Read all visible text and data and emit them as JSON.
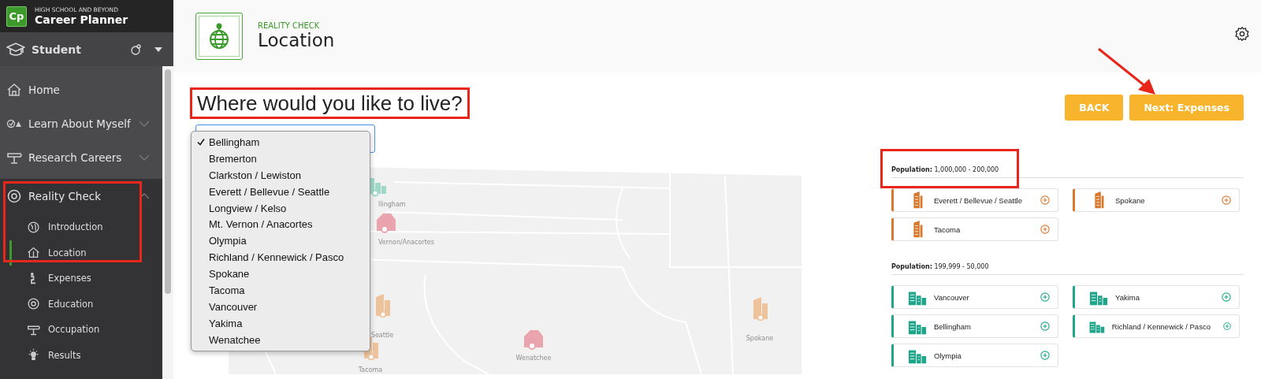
{
  "app": {
    "logo": "Cp",
    "subtitle": "HIGH SCHOOL AND BEYOND",
    "title": "Career Planner"
  },
  "user": {
    "name": "Student"
  },
  "nav": [
    {
      "kind": "link",
      "label": "Home"
    },
    {
      "kind": "group",
      "label": "Learn About Myself",
      "expanded": false
    },
    {
      "kind": "group",
      "label": "Research Careers",
      "expanded": false
    },
    {
      "kind": "group",
      "label": "Reality Check",
      "expanded": true,
      "children": [
        {
          "label": "Introduction",
          "selected": false
        },
        {
          "label": "Location",
          "selected": true
        },
        {
          "label": "Expenses",
          "selected": false
        },
        {
          "label": "Education",
          "selected": false
        },
        {
          "label": "Occupation",
          "selected": false
        },
        {
          "label": "Results",
          "selected": false
        }
      ]
    }
  ],
  "page": {
    "section": "REALITY CHECK",
    "title": "Location"
  },
  "question": "Where would you like to live?",
  "select": {
    "options": [
      {
        "label": "Bellingham",
        "selected": true
      },
      {
        "label": "Bremerton",
        "selected": false
      },
      {
        "label": "Clarkston / Lewiston",
        "selected": false
      },
      {
        "label": "Everett / Bellevue / Seattle",
        "selected": false
      },
      {
        "label": "Longview / Kelso",
        "selected": false
      },
      {
        "label": "Mt. Vernon / Anacortes",
        "selected": false
      },
      {
        "label": "Olympia",
        "selected": false
      },
      {
        "label": "Richland / Kennewick / Pasco",
        "selected": false
      },
      {
        "label": "Spokane",
        "selected": false
      },
      {
        "label": "Tacoma",
        "selected": false
      },
      {
        "label": "Vancouver",
        "selected": false
      },
      {
        "label": "Yakima",
        "selected": false
      },
      {
        "label": "Wenatchee",
        "selected": false
      }
    ]
  },
  "map_pins": [
    {
      "kind": "building",
      "label": "llingham",
      "color": "#9fd8c8"
    },
    {
      "kind": "barn",
      "label": "Vernon/Anacortes",
      "color": "#eaa4ae"
    },
    {
      "kind": "tower",
      "label": "Seattle",
      "color": "#eec39c"
    },
    {
      "kind": "tower",
      "label": "Tacoma",
      "color": "#eec39c"
    },
    {
      "kind": "barn",
      "label": "Wenatchee",
      "color": "#eaa4ae"
    },
    {
      "kind": "tower",
      "label": "Spokane",
      "color": "#eec39c"
    }
  ],
  "buttons": [
    "BACK",
    "Next: Expenses"
  ],
  "groups": [
    {
      "heading": "**Population:** 1,000,000 - 200,000",
      "kind": "tower",
      "color": "#d9782d",
      "cities": [
        "Everett / Bellevue / Seattle",
        "Spokane",
        "Tacoma"
      ]
    },
    {
      "heading": "**Population:** 199,999 - 50,000",
      "kind": "building",
      "color": "#1ea58a",
      "cities": [
        "Vancouver",
        "Yakima",
        "Bellingham",
        "Richland / Kennewick / Pasco",
        "Olympia"
      ]
    }
  ]
}
